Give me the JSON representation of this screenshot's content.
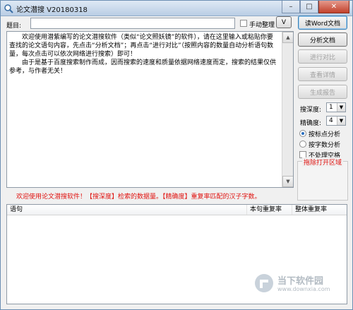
{
  "window": {
    "title": "论文潜搜 V20180318"
  },
  "top": {
    "topic_label": "题目:",
    "topic_value": "",
    "manual_checkbox_label": "手动整理",
    "v_button": "V"
  },
  "main_text": {
    "paragraph1": "欢迎使用潜紫编写的论文潜搜软件（类似“论文照妖镜”的软件），请在这里输入或粘贴你要查找的论文语句内容，先点击“分析文档”；再点击“进行对比”（按照内容的数量自动分析语句数量，每次点击可以依次网络进行搜索）即可！",
    "paragraph2": "由于是基于百度搜索制作而成，因而搜索的速度和质量依据网络速度而定，搜索的结果仅供参考，与作者无关！"
  },
  "side": {
    "read_word_button": "读Word文档",
    "analyze_button": "分析文档",
    "compare_button": "进行对比",
    "details_button": "查看详情",
    "report_button": "生成报告",
    "depth_label": "搜深度:",
    "depth_value": "1",
    "precision_label": "精确度:",
    "precision_value": "4",
    "radio_punct_label": "按标点分析",
    "radio_words_label": "按字数分析",
    "no_space_label": "不处理空格",
    "drag_label": "拖除打开区域"
  },
  "status": {
    "message": "欢迎使用论文潜搜软件！【搜深度】检索的数据量。【精确度】重复率匹配的汉子字数。"
  },
  "table": {
    "col_sentence": "语句",
    "col_sentence_rate": "本句重复率",
    "col_overall_rate": "整体重复率"
  },
  "watermark": {
    "cn": "当下软件园",
    "en": "www.downxia.com"
  },
  "colors": {
    "status_red": "#e0120f",
    "title_bar": "#b9cde4"
  }
}
